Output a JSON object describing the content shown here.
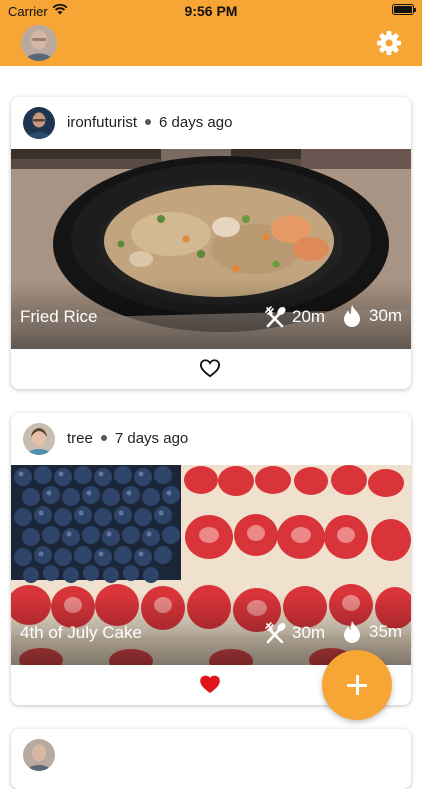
{
  "status_bar": {
    "carrier": "Carrier",
    "time": "9:56 PM"
  },
  "nav": {
    "accent_color": "#F7A534",
    "settings_icon": "gear-icon"
  },
  "posts": [
    {
      "username": "ironfuturist",
      "time_ago": "6 days ago",
      "title": "Fried Rice",
      "prep_time": "20m",
      "cook_time": "30m",
      "liked": false
    },
    {
      "username": "tree",
      "time_ago": "7 days ago",
      "title": "4th of July Cake",
      "prep_time": "30m",
      "cook_time": "35m",
      "liked": true
    }
  ],
  "fab": {
    "icon": "plus-icon"
  }
}
